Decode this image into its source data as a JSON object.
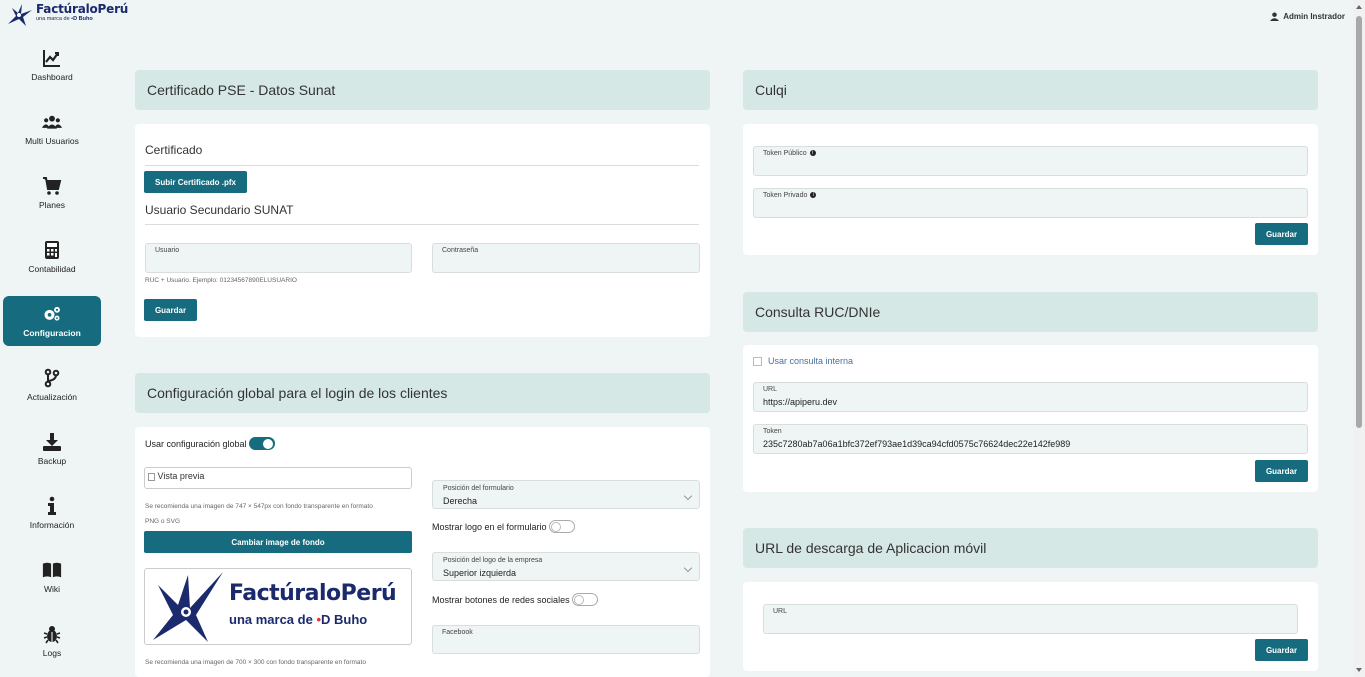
{
  "brand": {
    "name": "FactúraloPerú",
    "tagline": "una marca de",
    "partner": "Buho"
  },
  "user": {
    "name": "Admin Instrador"
  },
  "sidebar": {
    "items": [
      {
        "label": "Dashboard",
        "icon": "chart-line-icon"
      },
      {
        "label": "Multi Usuarios",
        "icon": "users-icon"
      },
      {
        "label": "Planes",
        "icon": "cart-icon"
      },
      {
        "label": "Contabilidad",
        "icon": "calculator-icon"
      },
      {
        "label": "Configuracion",
        "icon": "gears-icon",
        "active": true
      },
      {
        "label": "Actualización",
        "icon": "git-branch-icon"
      },
      {
        "label": "Backup",
        "icon": "download-icon"
      },
      {
        "label": "Información",
        "icon": "info-icon"
      },
      {
        "label": "Wiki",
        "icon": "book-icon"
      },
      {
        "label": "Logs",
        "icon": "bug-icon"
      }
    ]
  },
  "pse": {
    "title": "Certificado PSE - Datos Sunat",
    "cert_section": "Certificado",
    "upload_button": "Subir Certificado .pfx",
    "user_section": "Usuario Secundario SUNAT",
    "usuario_label": "Usuario",
    "contrasena_label": "Contraseña",
    "hint": "RUC + Usuario. Ejemplo: 01234567890ELUSUARIO",
    "save_button": "Guardar"
  },
  "login": {
    "title": "Configuración global para el login de los clientes",
    "use_global": "Usar configuración global",
    "preview_alt": "Vista previa",
    "bg_hint_1": "Se recomienda una imagen de 747 × 547px con fondo transparente en formato",
    "bg_hint_2": "PNG o SVG",
    "change_bg_button": "Cambiar image de fondo",
    "logo_hint": "Se recomienda una imagen de 700 × 300 con fondo transparente en formato",
    "form_position_label": "Posición del formulario",
    "form_position_value": "Derecha",
    "show_logo": "Mostrar logo en el formulario",
    "logo_position_label": "Posición del logo de la empresa",
    "logo_position_value": "Superior izquierda",
    "show_social": "Mostrar botones de redes sociales",
    "facebook_label": "Facebook",
    "logo_name": "FactúraloPerú",
    "logo_tagline": "una marca de",
    "logo_partner": "Buho"
  },
  "culqi": {
    "title": "Culqi",
    "public_token_label": "Token Público",
    "private_token_label": "Token Privado",
    "save_button": "Guardar"
  },
  "consulta": {
    "title": "Consulta RUC/DNIe",
    "internal_checkbox": "Usar consulta interna",
    "url_label": "URL",
    "url_value": "https://apiperu.dev",
    "token_label": "Token",
    "token_value": "235c7280ab7a06a1bfc372ef793ae1d39ca94cfd0575c76624dec22e142fe989",
    "save_button": "Guardar"
  },
  "mobile": {
    "title": "URL de descarga de Aplicacion móvil",
    "url_label": "URL",
    "save_button": "Guardar"
  },
  "colors": {
    "accent": "#166c7e",
    "header_bg": "#d5e8e5",
    "page_bg": "#eef5f4",
    "brand": "#1a2a6c"
  }
}
